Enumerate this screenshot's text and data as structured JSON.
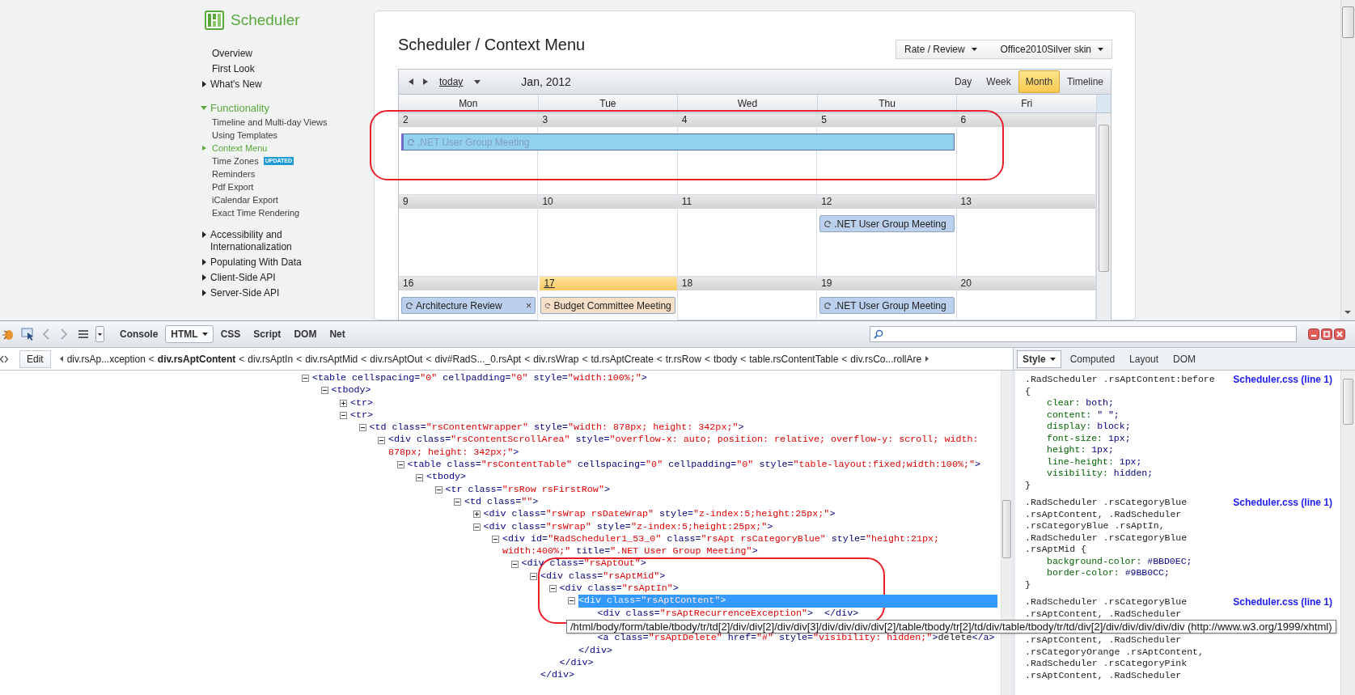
{
  "site": {
    "logo_text": "Scheduler",
    "nav": [
      {
        "kind": "link",
        "label": "Overview",
        "selected": false
      },
      {
        "kind": "link",
        "label": "First Look",
        "selected": false
      },
      {
        "kind": "group",
        "label": "What's New",
        "expanded": false,
        "selected": false
      },
      {
        "kind": "group",
        "label": "Functionality",
        "expanded": true,
        "selected": false,
        "children": [
          {
            "label": "Timeline and Multi-day Views",
            "selected": false
          },
          {
            "label": "Using Templates",
            "selected": false
          },
          {
            "label": "Context Menu",
            "selected": true
          },
          {
            "label": "Time Zones",
            "badge": "UPDATED",
            "selected": false
          },
          {
            "label": "Reminders",
            "selected": false
          },
          {
            "label": "Pdf Export",
            "selected": false
          },
          {
            "label": "iCalendar Export",
            "selected": false
          },
          {
            "label": "Exact Time Rendering",
            "selected": false
          }
        ]
      },
      {
        "kind": "group",
        "label": "Accessibility and Internationalization",
        "expanded": false,
        "selected": false
      },
      {
        "kind": "group",
        "label": "Populating With Data",
        "expanded": false,
        "selected": false
      },
      {
        "kind": "group",
        "label": "Client-Side API",
        "expanded": false,
        "selected": false
      },
      {
        "kind": "group",
        "label": "Server-Side API",
        "expanded": false,
        "selected": false
      }
    ]
  },
  "page_title": "Scheduler / Context Menu",
  "dropdowns": [
    {
      "label": "Rate / Review"
    },
    {
      "label": "Office2010Silver skin"
    }
  ],
  "scheduler": {
    "today_link": "today",
    "date_range": "Jan, 2012",
    "views": [
      {
        "label": "Day",
        "selected": false
      },
      {
        "label": "Week",
        "selected": false
      },
      {
        "label": "Month",
        "selected": true
      },
      {
        "label": "Timeline",
        "selected": false
      }
    ],
    "day_headers": [
      "Mon",
      "Tue",
      "Wed",
      "Thu",
      "Fri"
    ],
    "weeks": [
      {
        "days": [
          {
            "date": "2",
            "today": false,
            "appointments": [
              {
                "title": ".NET User Group Meeting",
                "color": "#92d2ee",
                "selected": true
              }
            ]
          },
          {
            "date": "3",
            "today": false,
            "continued": true
          },
          {
            "date": "4",
            "today": false,
            "continued": true
          },
          {
            "date": "5",
            "today": false,
            "continued": true
          },
          {
            "date": "6",
            "today": false
          }
        ]
      },
      {
        "days": [
          {
            "date": "9",
            "today": false
          },
          {
            "date": "10",
            "today": false
          },
          {
            "date": "11",
            "today": false
          },
          {
            "date": "12",
            "today": false,
            "appointments": [
              {
                "title": ".NET User Group Meeting",
                "color": "#bbd0ec",
                "selected": false
              }
            ]
          },
          {
            "date": "13",
            "today": false
          }
        ]
      },
      {
        "days": [
          {
            "date": "16",
            "today": false,
            "appointments": [
              {
                "title": "Architecture Review",
                "color": "#bbd0ec",
                "selected": false,
                "delete_glyph": "×"
              }
            ]
          },
          {
            "date": "17",
            "today": true,
            "appointments": [
              {
                "title": "Budget Committee Meeting",
                "color": "#f6dfc6",
                "selected": false
              }
            ]
          },
          {
            "date": "18",
            "today": false
          },
          {
            "date": "19",
            "today": false,
            "appointments": [
              {
                "title": ".NET User Group Meeting",
                "color": "#bbd0ec",
                "selected": false
              }
            ]
          },
          {
            "date": "20",
            "today": false
          }
        ]
      }
    ]
  },
  "firebug": {
    "panel_tabs": [
      {
        "label": "Console",
        "selected": false,
        "menu": false
      },
      {
        "label": "HTML",
        "selected": true,
        "menu": true
      },
      {
        "label": "CSS",
        "selected": false,
        "menu": false
      },
      {
        "label": "Script",
        "selected": false,
        "menu": false
      },
      {
        "label": "DOM",
        "selected": false,
        "menu": false
      },
      {
        "label": "Net",
        "selected": false,
        "menu": false
      }
    ],
    "edit_button": "Edit",
    "separator": "<",
    "breadcrumbs": [
      {
        "label": "div.rsAp...xception",
        "selected": false
      },
      {
        "label": "div.rsAptContent",
        "selected": true
      },
      {
        "label": "div.rsAptIn",
        "selected": false
      },
      {
        "label": "div.rsAptMid",
        "selected": false
      },
      {
        "label": "div.rsAptOut",
        "selected": false
      },
      {
        "label": "div#RadS..._0.rsApt",
        "selected": false
      },
      {
        "label": "div.rsWrap",
        "selected": false
      },
      {
        "label": "td.rsAptCreate",
        "selected": false
      },
      {
        "label": "tr.rsRow",
        "selected": false
      },
      {
        "label": "tbody",
        "selected": false
      },
      {
        "label": "table.rsContentTable",
        "selected": false
      },
      {
        "label": "div.rsCo...rollAre",
        "selected": false
      }
    ],
    "side_tabs": [
      {
        "label": "Style",
        "selected": true,
        "menu": true
      },
      {
        "label": "Computed",
        "selected": false,
        "menu": false
      },
      {
        "label": "Layout",
        "selected": false,
        "menu": false
      },
      {
        "label": "DOM",
        "selected": false,
        "menu": false
      }
    ],
    "html_tree": [
      {
        "kind": "branch",
        "expanded": true,
        "selected": false,
        "segments": [
          {
            "kind": "tag",
            "text": "<table"
          },
          {
            "kind": "attr",
            "text": " cellspacing="
          },
          {
            "kind": "value",
            "text": "\"0\""
          },
          {
            "kind": "attr",
            "text": " cellpadding="
          },
          {
            "kind": "value",
            "text": "\"0\""
          },
          {
            "kind": "attr",
            "text": " style="
          },
          {
            "kind": "value",
            "text": "\"width:100%;\""
          },
          {
            "kind": "tag",
            "text": ">"
          }
        ],
        "children": [
          {
            "kind": "branch",
            "expanded": true,
            "selected": false,
            "segments": [
              {
                "kind": "tag",
                "text": "<tbody>"
              }
            ],
            "children": [
              {
                "kind": "branch",
                "expanded": false,
                "selected": false,
                "segments": [
                  {
                    "kind": "tag",
                    "text": "<tr>"
                  }
                ]
              },
              {
                "kind": "branch",
                "expanded": true,
                "selected": false,
                "segments": [
                  {
                    "kind": "tag",
                    "text": "<tr>"
                  }
                ],
                "children": [
                  {
                    "kind": "branch",
                    "expanded": true,
                    "selected": false,
                    "segments": [
                      {
                        "kind": "tag",
                        "text": "<td"
                      },
                      {
                        "kind": "attr",
                        "text": " class="
                      },
                      {
                        "kind": "value",
                        "text": "\"rsContentWrapper\""
                      },
                      {
                        "kind": "attr",
                        "text": " style="
                      },
                      {
                        "kind": "value",
                        "text": "\"width: 878px; height: 342px;\""
                      },
                      {
                        "kind": "tag",
                        "text": ">"
                      }
                    ],
                    "children": [
                      {
                        "kind": "branch",
                        "expanded": true,
                        "selected": false,
                        "segments": [
                          {
                            "kind": "tag",
                            "text": "<div"
                          },
                          {
                            "kind": "attr",
                            "text": " class="
                          },
                          {
                            "kind": "value",
                            "text": "\"rsContentScrollArea\""
                          },
                          {
                            "kind": "attr",
                            "text": " style="
                          },
                          {
                            "kind": "value",
                            "text": "\"overflow-x: auto; position: relative; overflow-y: scroll; width: 878px; height: 342px;\""
                          },
                          {
                            "kind": "tag",
                            "text": ">"
                          }
                        ],
                        "children": [
                          {
                            "kind": "branch",
                            "expanded": true,
                            "selected": false,
                            "segments": [
                              {
                                "kind": "tag",
                                "text": "<table"
                              },
                              {
                                "kind": "attr",
                                "text": " class="
                              },
                              {
                                "kind": "value",
                                "text": "\"rsContentTable\""
                              },
                              {
                                "kind": "attr",
                                "text": " cellspacing="
                              },
                              {
                                "kind": "value",
                                "text": "\"0\""
                              },
                              {
                                "kind": "attr",
                                "text": " cellpadding="
                              },
                              {
                                "kind": "value",
                                "text": "\"0\""
                              },
                              {
                                "kind": "attr",
                                "text": " style="
                              },
                              {
                                "kind": "value",
                                "text": "\"table-layout:fixed;width:100%;\""
                              },
                              {
                                "kind": "tag",
                                "text": ">"
                              }
                            ],
                            "children": [
                              {
                                "kind": "branch",
                                "expanded": true,
                                "selected": false,
                                "segments": [
                                  {
                                    "kind": "tag",
                                    "text": "<tbody>"
                                  }
                                ],
                                "children": [
                                  {
                                    "kind": "branch",
                                    "expanded": true,
                                    "selected": false,
                                    "segments": [
                                      {
                                        "kind": "tag",
                                        "text": "<tr"
                                      },
                                      {
                                        "kind": "attr",
                                        "text": " class="
                                      },
                                      {
                                        "kind": "value",
                                        "text": "\"rsRow rsFirstRow\""
                                      },
                                      {
                                        "kind": "tag",
                                        "text": ">"
                                      }
                                    ],
                                    "children": [
                                      {
                                        "kind": "branch",
                                        "expanded": true,
                                        "selected": false,
                                        "segments": [
                                          {
                                            "kind": "tag",
                                            "text": "<td"
                                          },
                                          {
                                            "kind": "attr",
                                            "text": " class="
                                          },
                                          {
                                            "kind": "value",
                                            "text": "\"\""
                                          },
                                          {
                                            "kind": "tag",
                                            "text": ">"
                                          }
                                        ],
                                        "children": [
                                          {
                                            "kind": "branch",
                                            "expanded": false,
                                            "selected": false,
                                            "segments": [
                                              {
                                                "kind": "tag",
                                                "text": "<div"
                                              },
                                              {
                                                "kind": "attr",
                                                "text": " class="
                                              },
                                              {
                                                "kind": "value",
                                                "text": "\"rsWrap rsDateWrap\""
                                              },
                                              {
                                                "kind": "attr",
                                                "text": " style="
                                              },
                                              {
                                                "kind": "value",
                                                "text": "\"z-index:5;height:25px;\""
                                              },
                                              {
                                                "kind": "tag",
                                                "text": ">"
                                              }
                                            ]
                                          },
                                          {
                                            "kind": "branch",
                                            "expanded": true,
                                            "selected": false,
                                            "segments": [
                                              {
                                                "kind": "tag",
                                                "text": "<div"
                                              },
                                              {
                                                "kind": "attr",
                                                "text": " class="
                                              },
                                              {
                                                "kind": "value",
                                                "text": "\"rsWrap\""
                                              },
                                              {
                                                "kind": "attr",
                                                "text": " style="
                                              },
                                              {
                                                "kind": "value",
                                                "text": "\"z-index:5;height:25px;\""
                                              },
                                              {
                                                "kind": "tag",
                                                "text": ">"
                                              }
                                            ],
                                            "children": [
                                              {
                                                "kind": "branch",
                                                "expanded": true,
                                                "selected": false,
                                                "segments": [
                                                  {
                                                    "kind": "tag",
                                                    "text": "<div"
                                                  },
                                                  {
                                                    "kind": "attr",
                                                    "text": " id="
                                                  },
                                                  {
                                                    "kind": "value",
                                                    "text": "\"RadScheduler1_53_0\""
                                                  },
                                                  {
                                                    "kind": "attr",
                                                    "text": " class="
                                                  },
                                                  {
                                                    "kind": "value",
                                                    "text": "\"rsApt rsCategoryBlue\""
                                                  },
                                                  {
                                                    "kind": "attr",
                                                    "text": " style="
                                                  },
                                                  {
                                                    "kind": "value",
                                                    "text": "\"height:21px; width:400%;\""
                                                  },
                                                  {
                                                    "kind": "attr",
                                                    "text": " title="
                                                  },
                                                  {
                                                    "kind": "value",
                                                    "text": "\".NET User Group Meeting\""
                                                  },
                                                  {
                                                    "kind": "tag",
                                                    "text": ">"
                                                  }
                                                ],
                                                "children": [
                                                  {
                                                    "kind": "branch",
                                                    "expanded": true,
                                                    "selected": false,
                                                    "segments": [
                                                      {
                                                        "kind": "tag",
                                                        "text": "<div"
                                                      },
                                                      {
                                                        "kind": "attr",
                                                        "text": " class="
                                                      },
                                                      {
                                                        "kind": "value",
                                                        "text": "\"rsAptOut\""
                                                      },
                                                      {
                                                        "kind": "tag",
                                                        "text": ">"
                                                      }
                                                    ],
                                                    "children": [
                                                      {
                                                        "kind": "branch",
                                                        "expanded": true,
                                                        "selected": false,
                                                        "closing": "</div>",
                                                        "segments": [
                                                          {
                                                            "kind": "tag",
                                                            "text": "<div"
                                                          },
                                                          {
                                                            "kind": "attr",
                                                            "text": " class="
                                                          },
                                                          {
                                                            "kind": "value",
                                                            "text": "\"rsAptMid\""
                                                          },
                                                          {
                                                            "kind": "tag",
                                                            "text": ">"
                                                          }
                                                        ],
                                                        "children": [
                                                          {
                                                            "kind": "branch",
                                                            "expanded": true,
                                                            "selected": false,
                                                            "closing": "</div>",
                                                            "segments": [
                                                              {
                                                                "kind": "tag",
                                                                "text": "<div"
                                                              },
                                                              {
                                                                "kind": "attr",
                                                                "text": " class="
                                                              },
                                                              {
                                                                "kind": "value",
                                                                "text": "\"rsAptIn\""
                                                              },
                                                              {
                                                                "kind": "tag",
                                                                "text": ">"
                                                              }
                                                            ],
                                                            "children": [
                                                              {
                                                                "kind": "branch",
                                                                "expanded": true,
                                                                "selected": true,
                                                                "closing": "</div>",
                                                                "segments": [
                                                                  {
                                                                    "kind": "tag",
                                                                    "text": "<div"
                                                                  },
                                                                  {
                                                                    "kind": "attr",
                                                                    "text": " class="
                                                                  },
                                                                  {
                                                                    "kind": "value",
                                                                    "text": "\"rsAptContent\""
                                                                  },
                                                                  {
                                                                    "kind": "tag",
                                                                    "text": ">"
                                                                  }
                                                                ],
                                                                "children": [
                                                                  {
                                                                    "kind": "leaf",
                                                                    "selected": false,
                                                                    "tooltip": "/html/body/form/table/tbody/tr/td[2]/div/div[2]/div/div[3]/div/div/div/div[2]/table/tbody/tr[2]/td/div/table/tbody/tr/td/div[2]/div/div/div/div/div (http://www.w3.org/1999/xhtml)",
                                                                    "segments": [
                                                                      {
                                                                        "kind": "tag",
                                                                        "text": "<div"
                                                                      },
                                                                      {
                                                                        "kind": "attr",
                                                                        "text": " class="
                                                                      },
                                                                      {
                                                                        "kind": "value",
                                                                        "text": "\"rsAptRecurrenceException\""
                                                                      },
                                                                      {
                                                                        "kind": "tag",
                                                                        "text": ">"
                                                                      },
                                                                      {
                                                                        "kind": "tag",
                                                                        "text": "  </div>"
                                                                      }
                                                                    ]
                                                                  },
                                                                  {
                                                                    "kind": "leaf",
                                                                    "selected": false,
                                                                    "segments": [
                                                                      {
                                                                        "kind": "tag",
                                                                        "text": "<a"
                                                                      },
                                                                      {
                                                                        "kind": "attr",
                                                                        "text": " class="
                                                                      },
                                                                      {
                                                                        "kind": "value",
                                                                        "text": "\"rsAptDelete\""
                                                                      },
                                                                      {
                                                                        "kind": "attr",
                                                                        "text": " href="
                                                                      },
                                                                      {
                                                                        "kind": "value",
                                                                        "text": "\"#\""
                                                                      },
                                                                      {
                                                                        "kind": "attr",
                                                                        "text": " style="
                                                                      },
                                                                      {
                                                                        "kind": "value",
                                                                        "text": "\"visibility: hidden;\""
                                                                      },
                                                                      {
                                                                        "kind": "tag",
                                                                        "text": ">"
                                                                      },
                                                                      {
                                                                        "kind": "text",
                                                                        "text": "delete"
                                                                      },
                                                                      {
                                                                        "kind": "tag",
                                                                        "text": "</a>"
                                                                      }
                                                                    ]
                                                                  }
                                                                ]
                                                              }
                                                            ]
                                                          }
                                                        ]
                                                      }
                                                    ]
                                                  }
                                                ]
                                              }
                                            ]
                                          }
                                        ]
                                      }
                                    ]
                                  }
                                ]
                              }
                            ]
                          }
                        ]
                      }
                    ]
                  }
                ]
              }
            ]
          }
        ]
      }
    ],
    "style_rules": [
      {
        "selector_lines": [
          ".RadScheduler .rsAptContent:before",
          "{"
        ],
        "declarations": [
          {
            "property": "clear:",
            "value": "both;"
          },
          {
            "property": "content:",
            "value": "\" \";"
          },
          {
            "property": "display:",
            "value": "block;"
          },
          {
            "property": "font-size:",
            "value": "1px;"
          },
          {
            "property": "height:",
            "value": "1px;"
          },
          {
            "property": "line-height:",
            "value": "1px;"
          },
          {
            "property": "visibility:",
            "value": "hidden;"
          }
        ],
        "close": "}",
        "source": "Scheduler.css (line 1)"
      },
      {
        "selector_lines": [
          ".RadScheduler .rsCategoryBlue",
          ".rsAptContent, .RadScheduler",
          ".rsCategoryBlue .rsAptIn,",
          ".RadScheduler .rsCategoryBlue",
          ".rsAptMid {"
        ],
        "declarations": [
          {
            "property": "background-color:",
            "value": "#BBD0EC;"
          },
          {
            "property": "border-color:",
            "value": "#9BB0CC;"
          }
        ],
        "close": "}",
        "source": "Scheduler.css (line 1)"
      },
      {
        "selector_lines": [
          ".RadScheduler .rsCategoryBlue",
          ".rsAptContent, .RadScheduler",
          ".rsAptContent, .RadScheduler",
          ".rsCategoryOrange .rsAptContent,",
          ".RadScheduler .rsCategoryPink",
          ".rsAptContent, .RadScheduler"
        ],
        "source": "Scheduler.css (line 1)"
      }
    ]
  }
}
